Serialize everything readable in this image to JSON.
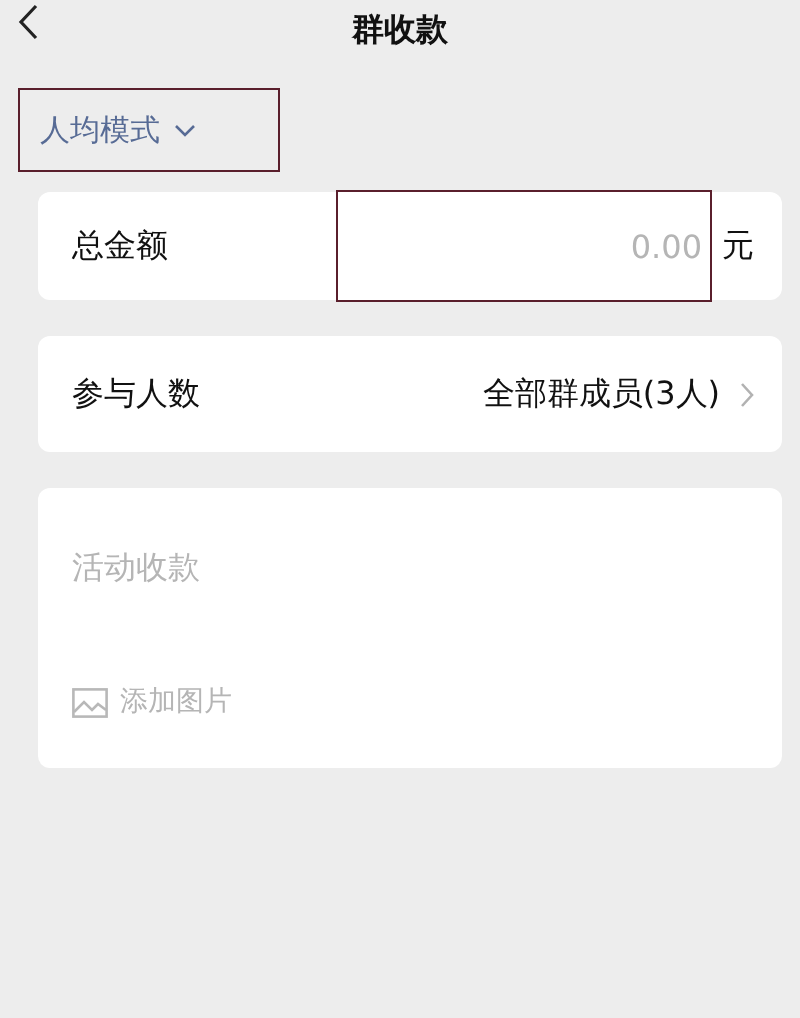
{
  "header": {
    "title": "群收款"
  },
  "mode": {
    "label": "人均模式"
  },
  "amount": {
    "label": "总金额",
    "placeholder": "0.00",
    "unit": "元"
  },
  "participants": {
    "label": "参与人数",
    "value": "全部群成员(3人)"
  },
  "note": {
    "placeholder": "活动收款",
    "add_image": "添加图片"
  }
}
